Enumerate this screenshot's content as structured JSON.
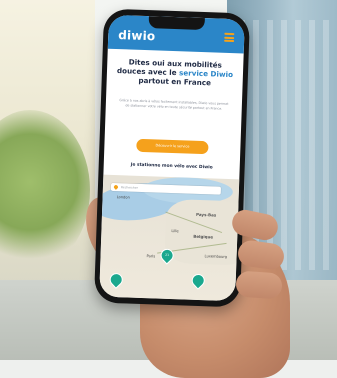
{
  "app": {
    "logo": "diwio",
    "hero_title_part1": "Dites oui aux mobilités douces avec le ",
    "hero_title_accent": "service Diwio",
    "hero_title_part2": " partout en France",
    "hero_body": "Grâce à nos abris à vélos facilement installables, Diwio vous permet de stationner votre vélo en toute sécurité partout en France.",
    "cta_label": "Découvrir le service",
    "section_title": "Je stationne mon vélo avec Diwio"
  },
  "map": {
    "search_placeholder": "Rechercher",
    "labels": {
      "pays_bas": "Pays-Bas",
      "belgique": "Belgique",
      "luxembourg": "Luxembourg",
      "london": "London",
      "lille": "Lille",
      "paris": "Paris"
    },
    "pins": [
      {
        "label": "21"
      },
      {
        "label": ""
      },
      {
        "label": ""
      }
    ]
  },
  "colors": {
    "brand_blue": "#2b86c8",
    "accent_orange": "#f5a11c",
    "pin_green": "#1aa88e"
  }
}
